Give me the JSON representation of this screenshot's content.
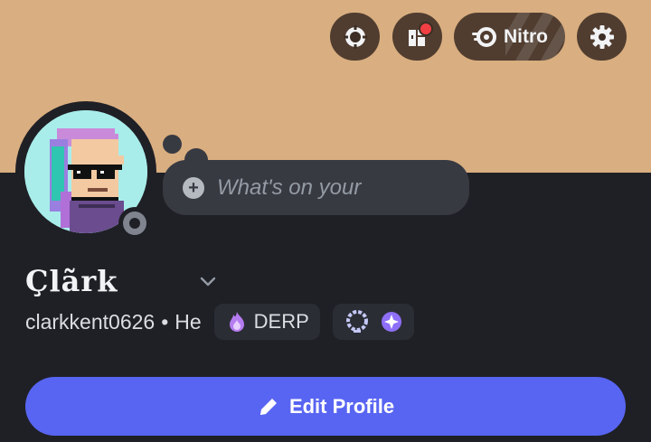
{
  "profile": {
    "display_name": "Çlãrk",
    "username": "clarkkent0626",
    "separator": "•",
    "pronouns": "He",
    "status_placeholder": "What's on your",
    "guild_tag": {
      "label": "DERP",
      "icon": "purple-flame-icon"
    },
    "badges": [
      "laurel-wreath-badge-icon",
      "nitro-gem-badge-icon"
    ],
    "status": "offline"
  },
  "header_buttons": [
    {
      "name": "server-boost-icon"
    },
    {
      "name": "shop-icon",
      "notification": true
    },
    {
      "name": "nitro",
      "label": "Nitro"
    },
    {
      "name": "settings-icon"
    }
  ],
  "actions": {
    "edit_profile_label": "Edit Profile"
  },
  "colors": {
    "banner": "#d9ae80",
    "background": "#1f2026",
    "primary_button": "#5865f2",
    "chip": "#2b2d35",
    "header_button": "#3c2e24"
  }
}
